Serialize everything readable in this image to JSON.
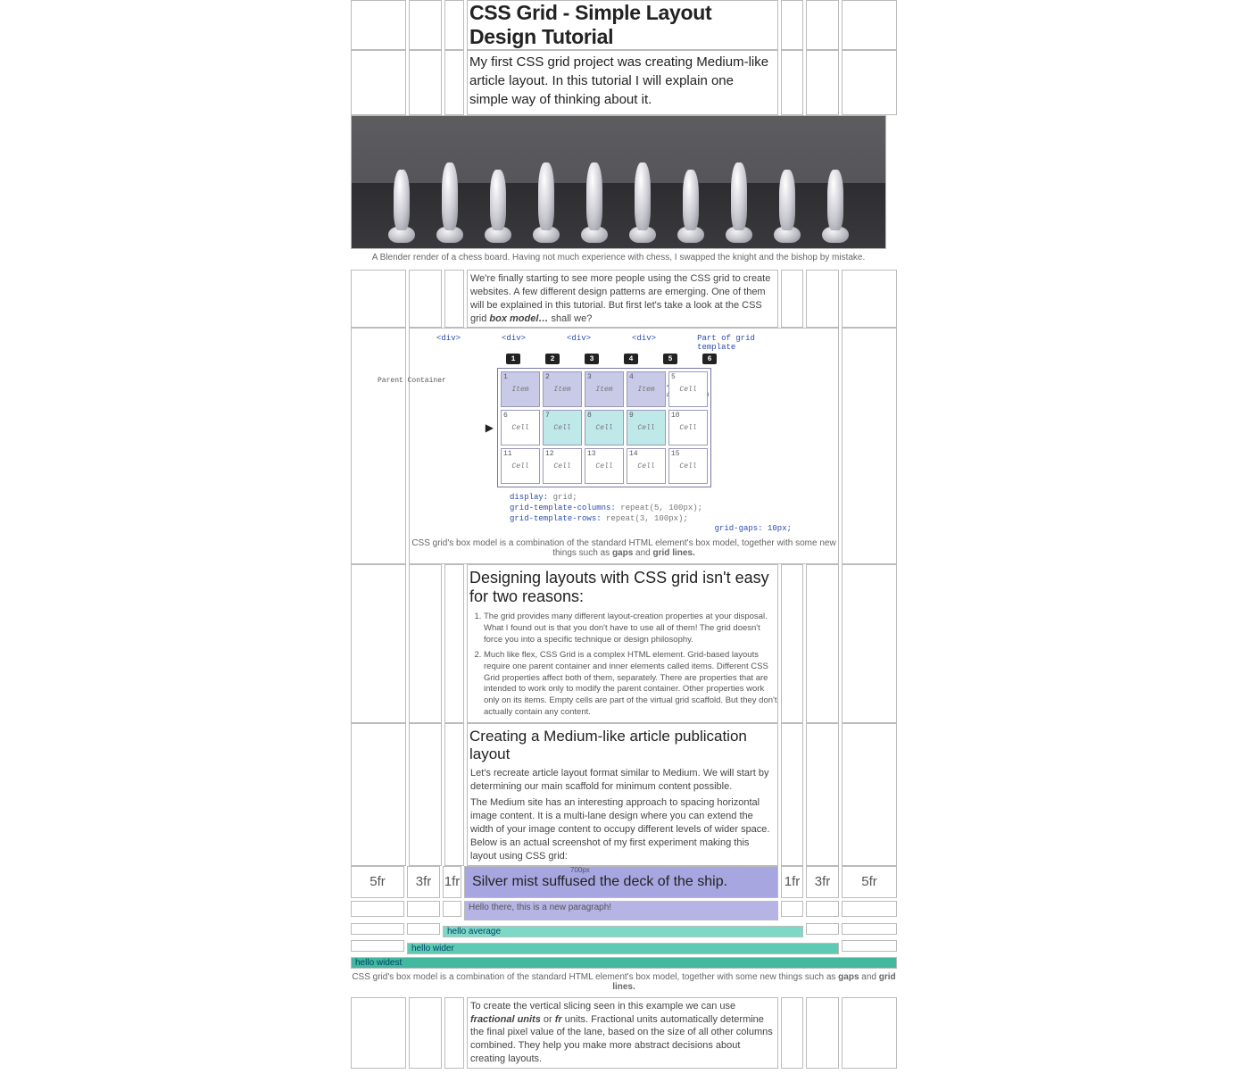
{
  "title": "CSS Grid - Simple Layout Design Tutorial",
  "subtitle": "My first CSS grid project was creating Medium-like article layout. In this tutorial I will explain one simple way of thinking about it.",
  "hero_caption": "A Blender render of a chess board. Having not much experience with chess, I swapped the knight and the bishop by mistake.",
  "intro_para": "We're finally starting to see more people using the CSS grid to create websites. A few different design patterns are emerging. One of them will be explained in this tutorial. But first let's take a look at the CSS grid ",
  "intro_para_em": "box model…",
  "intro_para_tail": " shall we?",
  "bm": {
    "div": "<div>",
    "part": "Part of grid template",
    "parent": "Parent Container",
    "item": "Item",
    "cell": "Cell",
    "span_a": "1 <div>",
    "span_b": "spanned area",
    "code1": "display:",
    "code1v": " grid;",
    "code2": "grid-template-columns:",
    "code2v": " repeat(5, 100px);",
    "code3": "grid-template-rows:",
    "code3v": " repeat(3, 100px);",
    "ggap": "grid-gaps:",
    "ggapv": " 10px;"
  },
  "bm_caption_a": "CSS grid's box model is a combination of the standard HTML element's box model, together with some new things such as ",
  "bm_caption_b": "gaps",
  "bm_caption_c": " and ",
  "bm_caption_d": "grid lines.",
  "h2": "Designing layouts with CSS grid isn't easy for two reasons:",
  "reasons": [
    "The grid provides many different layout-creation properties at your disposal. What I found out is that you don't have to use all of them! The grid doesn't force you into a specific technique or design philosophy.",
    "Much like flex, CSS Grid is a complex HTML element. Grid-based layouts require one parent container and inner elements called items. Different CSS Grid properties affect both of them, separately. There are properties that are intended to work only to modify the parent container. Other properties work only on its items. Empty cells are part of the virtual grid scaffold. But they don't actually contain any content."
  ],
  "h3": "Creating a Medium-like article publication layout",
  "p_after_h3_a": "Let's recreate article layout format similar to Medium. We will start by determining our main scaffold for minimum content possible.",
  "p_after_h3_b": "The Medium site has an interesting approach to spacing horizontal image content. It is a multi-lane design where you can extend the width of your image content to occupy different levels of wider space. Below is an actual screenshot of my first experiment making this layout using CSS grid:",
  "lanes": {
    "fr5": "5fr",
    "fr3": "3fr",
    "fr1": "1fr",
    "headline": "Silver mist suffused the deck of the ship.",
    "px": "700px",
    "para": "Hello there, this is a new paragraph!",
    "avg": "hello average",
    "wider": "hello wider",
    "widest": "hello widest"
  },
  "lanes_caption_a": "CSS grid's box model is a combination of the standard HTML element's box model, together with some new things such as ",
  "lanes_caption_b": "gaps",
  "lanes_caption_c": " and ",
  "lanes_caption_d": "grid lines.",
  "final_p_a": "To create the vertical slicing seen in this example we can use ",
  "final_p_b": "fractional units",
  "final_p_c": " or ",
  "final_p_d": "fr",
  "final_p_e": " units. Fractional units automatically determine the final pixel value of the lane, based on the size of all other columns combined. They help you make more abstract decisions about creating layouts."
}
